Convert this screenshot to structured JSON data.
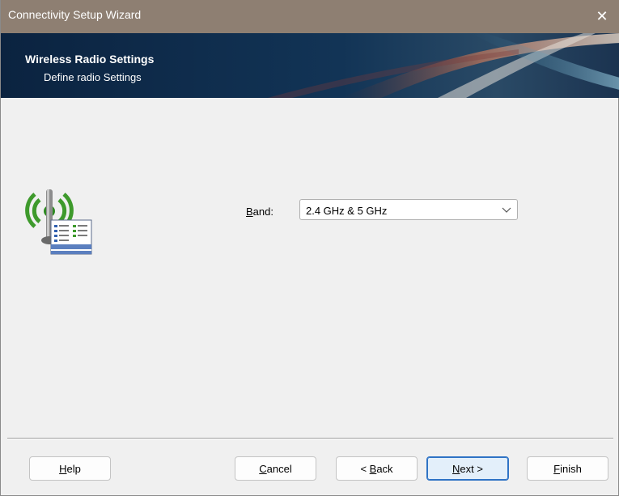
{
  "window": {
    "title": "Connectivity Setup Wizard",
    "close_glyph": "✕"
  },
  "banner": {
    "heading": "Wireless Radio Settings",
    "subheading": "Define radio Settings"
  },
  "form": {
    "band_label_key": "B",
    "band_label_rest": "and:",
    "band_value": "2.4 GHz & 5 GHz",
    "icon": "wireless-radio-settings-icon"
  },
  "buttons": {
    "help": {
      "key": "H",
      "rest": "elp"
    },
    "cancel": {
      "key": "C",
      "rest": "ancel"
    },
    "back": {
      "pre": "< ",
      "key": "B",
      "rest": "ack"
    },
    "next": {
      "key": "N",
      "rest": "ext >"
    },
    "finish": {
      "key": "F",
      "rest": "inish"
    }
  },
  "colors": {
    "titlebar": "#8e7f72",
    "banner": "#0d2a44",
    "default_button_border": "#2f73c5"
  }
}
